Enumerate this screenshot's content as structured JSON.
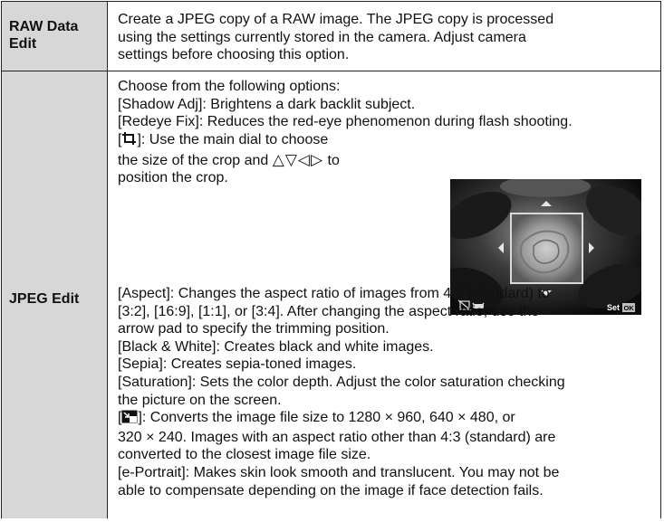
{
  "rows": [
    {
      "header": [
        "RAW Data",
        "Edit"
      ],
      "lines": [
        "Create a JPEG copy of a RAW image. The JPEG copy is processed",
        "using the settings currently stored in the camera. Adjust camera",
        "settings before choosing this option."
      ]
    },
    {
      "header": [
        "JPEG Edit"
      ],
      "intro": [
        "Choose from the following options:",
        "[Shadow Adj]: Brightens a dark backlit subject.",
        "[Redeye Fix]: Reduces the red-eye phenomenon during flash shooting."
      ],
      "crop": {
        "icon": "crop-icon",
        "line1_prefix": "[",
        "line1_suffix": "]: Use the main dial to choose",
        "line2_prefix": "the size of the crop and ",
        "arrows": "△▽◁▷",
        "line2_suffix": " to",
        "line3": "position the crop."
      },
      "preview": {
        "left_icons": "delete-icon, face-icon",
        "set_label": "Set",
        "ok_label": "OK"
      },
      "aspect": [
        "[Aspect]: Changes the aspect ratio of images from 4:3 (standard) to",
        "[3:2], [16:9], [1:1], or [3:4]. After changing the aspect ratio, use the",
        "arrow pad to specify the trimming position."
      ],
      "bw": "[Black & White]: Creates black and white images.",
      "sepia": "[Sepia]: Creates sepia-toned images.",
      "saturation": [
        "[Saturation]: Sets the color depth. Adjust the color saturation checking",
        "the picture on the screen."
      ],
      "resize": {
        "icon": "resize-icon",
        "line1_prefix": "[",
        "line1_suffix": "]: Converts the image file size to 1280 × 960, 640 × 480, or",
        "line2": "320 × 240. Images with an aspect ratio other than 4:3 (standard) are",
        "line3": "converted to the closest image file size."
      },
      "portrait": [
        "[e-Portrait]: Makes skin look smooth and translucent. You may not be",
        "able to compensate depending on the image if face detection fails."
      ]
    }
  ],
  "colors": {
    "header_bg": "#d7d7d7",
    "rule": "#222222"
  }
}
